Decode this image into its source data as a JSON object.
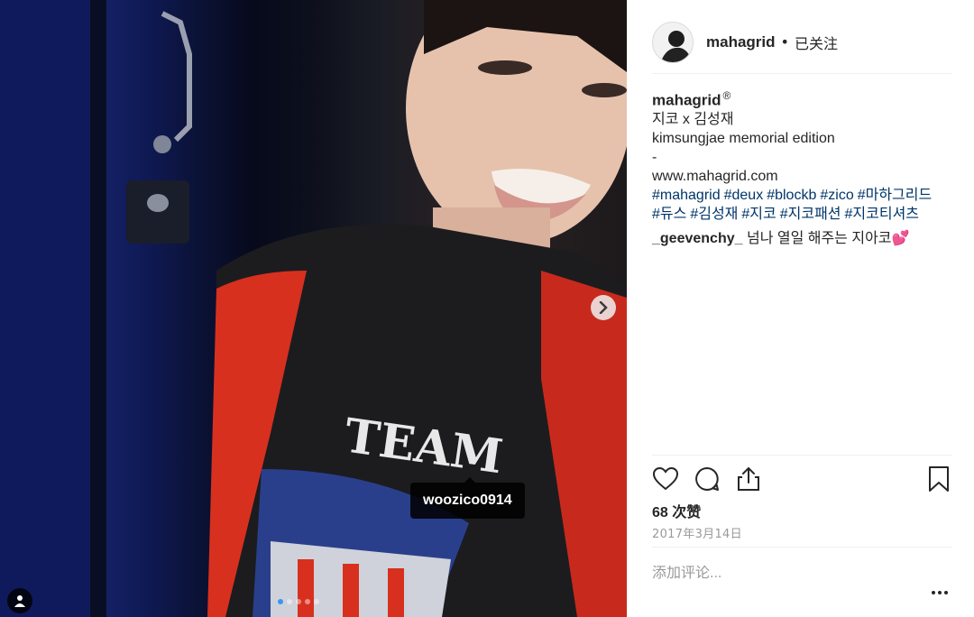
{
  "post": {
    "image_tag": "woozico0914",
    "carousel": {
      "total": 5,
      "current": 1
    }
  },
  "header": {
    "username": "mahagrid",
    "separator": "•",
    "follow_status": "已关注"
  },
  "caption": {
    "username": "mahagrid",
    "registered_mark": "®",
    "lines": [
      "지코 x 김성재",
      "kimsungjae memorial edition",
      "-",
      "www.mahagrid.com"
    ],
    "hashtags": [
      "#mahagrid",
      "#deux",
      "#blockb",
      "#zico",
      "#마하그리드",
      "#듀스",
      "#김성재",
      "#지코",
      "#지코패션",
      "#지코티셔츠"
    ]
  },
  "comment": {
    "username": "_geevenchy_",
    "text": "넘나 열일 해주는 지아코💕"
  },
  "actions": {
    "icons": [
      "heart-icon",
      "comment-icon",
      "share-icon",
      "bookmark-icon"
    ]
  },
  "likes_label": "68 次赞",
  "date": "2017年3月14日",
  "comment_input": {
    "placeholder": "添加评论..."
  },
  "colors": {
    "text": "#262626",
    "hashtag": "#003569",
    "muted": "#999999",
    "divider": "#efefef",
    "dot_active": "#3897f0"
  }
}
